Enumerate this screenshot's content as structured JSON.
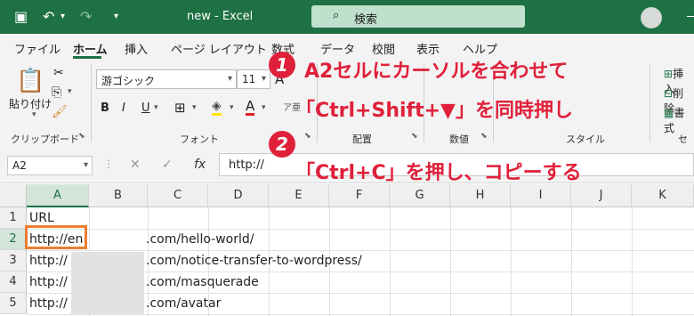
{
  "window": {
    "title": "new  -  Excel",
    "search_label": "検索"
  },
  "tabs": [
    "ファイル",
    "ホーム",
    "挿入",
    "ページ レイアウト",
    "数式",
    "データ",
    "校閲",
    "表示",
    "ヘルプ"
  ],
  "ribbon": {
    "paste_label": "貼り付け",
    "font_name": "游ゴシック",
    "font_size": "11",
    "bold": "B",
    "italic": "I",
    "underline": "U",
    "font_color_glyph": "A",
    "groups": {
      "clipboard": "クリップボード",
      "font": "フォント",
      "alignment": "配置",
      "number": "数値",
      "styles": "スタイル",
      "cells": "セル"
    },
    "cells_items": [
      "挿入",
      "削除",
      "書式"
    ]
  },
  "formula_bar": {
    "name_box": "A2",
    "content": "http://"
  },
  "sheet": {
    "columns": [
      "A",
      "B",
      "C",
      "D",
      "E",
      "F",
      "G",
      "H",
      "I",
      "J",
      "K"
    ],
    "rows": [
      "1",
      "2",
      "3",
      "4",
      "5"
    ],
    "cells": {
      "A1": "URL",
      "A2_left": "http://en",
      "A2_right": ".com/hello-world/",
      "A3_left": "http://",
      "A3_right": ".com/notice-transfer-to-wordpress/",
      "A4_left": "http://",
      "A4_right": ".com/masquerade",
      "A5_left": "http://",
      "A5_right": ".com/avatar"
    }
  },
  "annotations": {
    "step1_badge": "1",
    "step1_line1": "A2セルにカーソルを合わせて",
    "step1_line2": "「Ctrl+Shift+▼」を同時押し",
    "step2_badge": "2",
    "step2_line1": "「Ctrl+C」を押し、コピーする"
  },
  "colors": {
    "accent": "#1e7145",
    "annotation": "#e0203a",
    "selection": "#ed7d31"
  }
}
